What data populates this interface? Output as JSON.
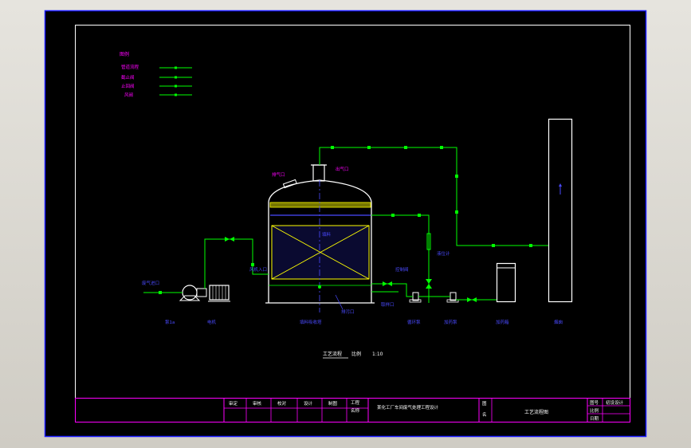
{
  "colors": {
    "background": "#000000",
    "frame": "#1a1aff",
    "equipment": "#ffffff",
    "pipe": "#00ff00",
    "label": "#4a4aff",
    "legend_text": "#ff00ff",
    "title_block": "#ff00ff",
    "packing": "#ffff00",
    "annotation": "#ff00ff"
  },
  "legend": {
    "title": "图例",
    "items": [
      {
        "label": "管道流程",
        "symbol": "green-line"
      },
      {
        "label": "截止阀",
        "symbol": "green-line"
      },
      {
        "label": "止回阀",
        "symbol": "green-line"
      },
      {
        "label": "风阀",
        "symbol": "green-line"
      }
    ]
  },
  "equipment_labels": {
    "pump": "泵1a",
    "motor": "电机",
    "tower": "填料吸收塔",
    "pump2": "循环泵",
    "pump3": "加药泵",
    "tank": "加药箱",
    "chimney": "烟囱"
  },
  "annotations": {
    "vent": "排气口",
    "top_outlet": "出气口",
    "inlet": "废气进口",
    "level": "液位计",
    "drain": "排污口",
    "valve": "控制阀",
    "sampling": "取样口",
    "middle": "填料",
    "fan_inlet": "风机入口"
  },
  "drawing_caption": {
    "title": "工艺流程",
    "scale_label": "比例",
    "scale_value": "1:10"
  },
  "title_block": {
    "headers": [
      "审定",
      "审核",
      "校对",
      "设计",
      "制图"
    ],
    "col_a": [
      "工程",
      "名称"
    ],
    "project_name": "某化工厂车间废气处理工程设计",
    "col_b": [
      "图",
      "名"
    ],
    "drawing_name": "工艺流程图",
    "meta_labels": [
      "图号",
      "比例",
      "日期"
    ],
    "meta_values": [
      "初设设计",
      "",
      ""
    ]
  }
}
